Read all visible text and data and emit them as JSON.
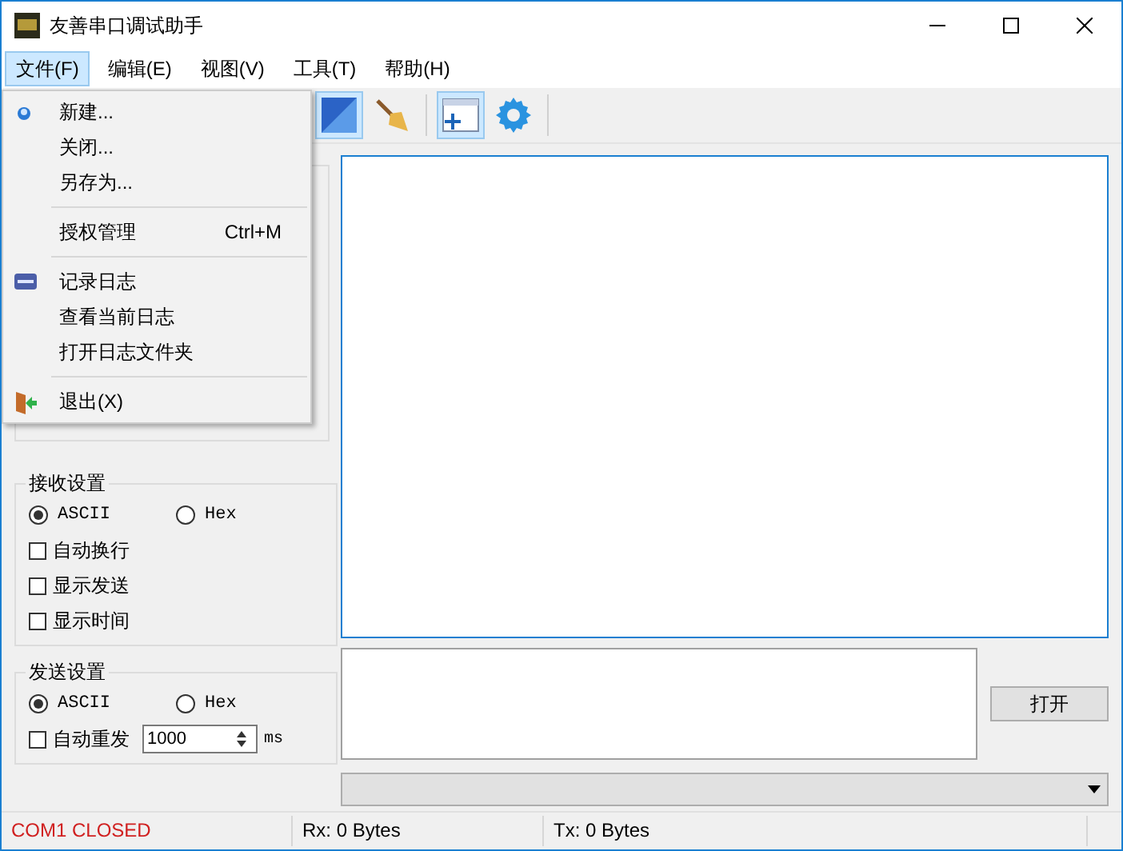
{
  "window": {
    "title": "友善串口调试助手"
  },
  "menu_bar": [
    {
      "label": "文件(F)",
      "selected": true
    },
    {
      "label": "编辑(E)",
      "selected": false
    },
    {
      "label": "视图(V)",
      "selected": false
    },
    {
      "label": "工具(T)",
      "selected": false
    },
    {
      "label": "帮助(H)",
      "selected": false
    }
  ],
  "toolbar": [
    {
      "kind": "panel",
      "selected": true
    },
    {
      "kind": "broom",
      "selected": false
    },
    {
      "kind": "window",
      "selected": true
    },
    {
      "kind": "gear",
      "selected": false
    }
  ],
  "file_menu": [
    [
      {
        "kind": "new",
        "label": "新建..."
      },
      {
        "kind": "plain",
        "label": "关闭..."
      },
      {
        "kind": "plain",
        "label": "另存为..."
      }
    ],
    [
      {
        "kind": "plain",
        "label": "授权管理",
        "shortcut": "Ctrl+M"
      }
    ],
    [
      {
        "kind": "log",
        "label": "记录日志"
      },
      {
        "kind": "plain",
        "label": "查看当前日志"
      },
      {
        "kind": "plain",
        "label": "打开日志文件夹"
      }
    ],
    [
      {
        "kind": "exit",
        "label": "退出(X)"
      }
    ]
  ],
  "receive_settings": {
    "title": "接收设置",
    "encodings": [
      {
        "label": "ASCII",
        "selected": true
      },
      {
        "label": "Hex",
        "selected": false
      }
    ],
    "options": [
      {
        "label": "自动换行",
        "checked": false
      },
      {
        "label": "显示发送",
        "checked": false
      },
      {
        "label": "显示时间",
        "checked": false
      }
    ]
  },
  "send_settings": {
    "title": "发送设置",
    "encodings": [
      {
        "label": "ASCII",
        "selected": true
      },
      {
        "label": "Hex",
        "selected": false
      }
    ],
    "auto_resend": {
      "label": "自动重发",
      "checked": false,
      "value": "1000",
      "unit": "ms"
    }
  },
  "open_button": "打开",
  "status_bar": {
    "port": "COM1 CLOSED",
    "rx": "Rx: 0 Bytes",
    "tx": "Tx: 0 Bytes"
  }
}
